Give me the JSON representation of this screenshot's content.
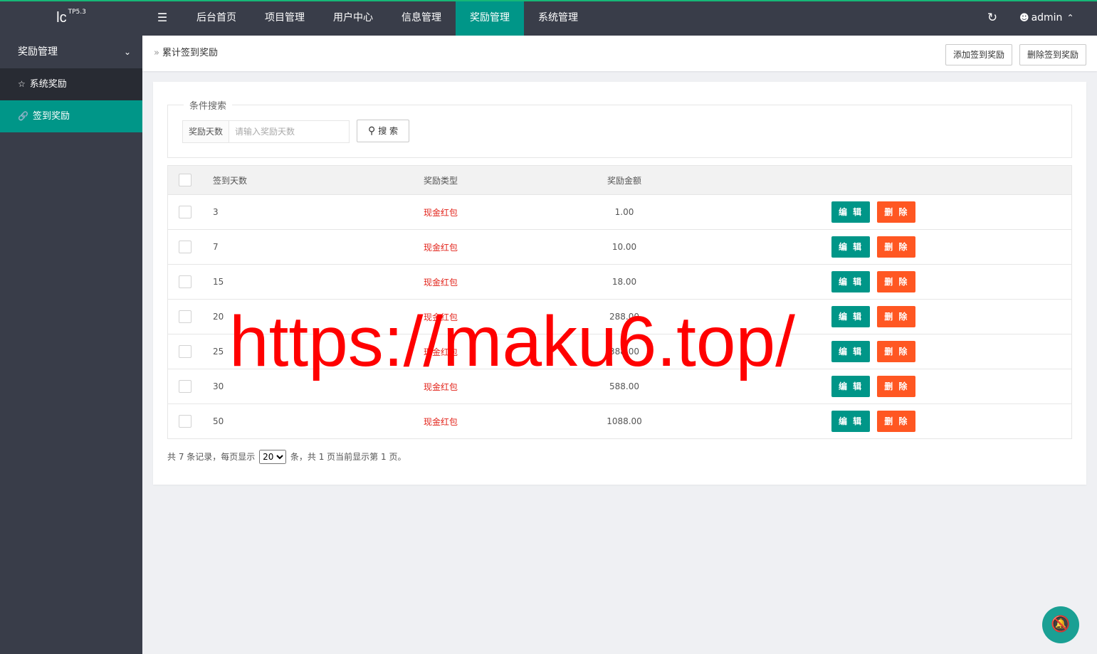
{
  "app": {
    "logo": "lc",
    "logo_sup": "TP5.3",
    "user_name": "admin"
  },
  "nav": {
    "items": [
      "后台首页",
      "项目管理",
      "用户中心",
      "信息管理",
      "奖励管理",
      "系统管理"
    ],
    "active_index": 4
  },
  "sidebar": {
    "group_label": "奖励管理",
    "items": [
      {
        "label": "系统奖励",
        "icon": "star-icon",
        "active": false
      },
      {
        "label": "签到奖励",
        "icon": "link-icon",
        "active": true
      }
    ]
  },
  "breadcrumb": {
    "current": "累计签到奖励"
  },
  "toolbar": {
    "add_label": "添加签到奖励",
    "delete_label": "删除签到奖励"
  },
  "search": {
    "legend": "条件搜索",
    "field_label": "奖励天数",
    "placeholder": "请输入奖励天数",
    "button_label": "搜 索"
  },
  "table": {
    "headers": [
      "签到天数",
      "奖励类型",
      "奖励金额"
    ],
    "edit_label": "编 辑",
    "delete_label": "删 除",
    "rows": [
      {
        "days": "3",
        "type": "现金红包",
        "amount": "1.00"
      },
      {
        "days": "7",
        "type": "现金红包",
        "amount": "10.00"
      },
      {
        "days": "15",
        "type": "现金红包",
        "amount": "18.00"
      },
      {
        "days": "20",
        "type": "现金红包",
        "amount": "288.00"
      },
      {
        "days": "25",
        "type": "现金红包",
        "amount": "388.00"
      },
      {
        "days": "30",
        "type": "现金红包",
        "amount": "588.00"
      },
      {
        "days": "50",
        "type": "现金红包",
        "amount": "1088.00"
      }
    ]
  },
  "pager": {
    "prefix": "共 7 条记录，每页显示",
    "page_size": "20",
    "suffix": "条，共 1 页当前显示第 1 页。"
  },
  "watermark": "https://maku6.top/",
  "colors": {
    "topbar": "#393d49",
    "accent": "#009688",
    "danger": "#ff5722",
    "link_red": "#e2231a",
    "watermark": "#ff0000"
  }
}
